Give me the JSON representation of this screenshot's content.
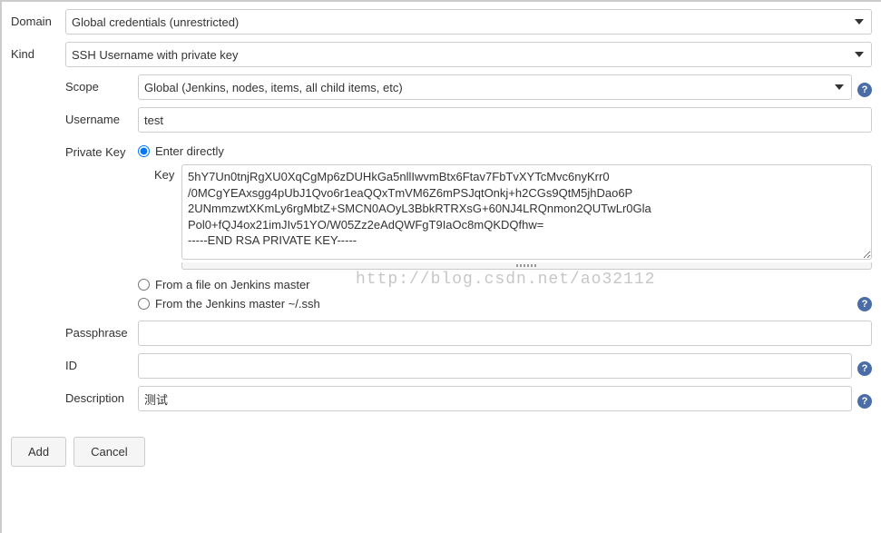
{
  "domain": {
    "label": "Domain",
    "value": "Global credentials (unrestricted)"
  },
  "kind": {
    "label": "Kind",
    "value": "SSH Username with private key"
  },
  "scope": {
    "label": "Scope",
    "value": "Global (Jenkins, nodes, items, all child items, etc)"
  },
  "username": {
    "label": "Username",
    "value": "test"
  },
  "privateKey": {
    "label": "Private Key",
    "option_enter_directly": "Enter directly",
    "key_label": "Key",
    "key_value": "5hY7Un0tnjRgXU0XqCgMp6zDUHkGa5nllIwvmBtx6Ftav7FbTvXYTcMvc6nyKrr0\n/0MCgYEAxsgg4pUbJ1Qvo6r1eaQQxTmVM6Z6mPSJqtOnkj+h2CGs9QtM5jhDao6P\n2UNmmzwtXKmLy6rgMbtZ+SMCN0AOyL3BbkRTRXsG+60NJ4LRQnmon2QUTwLr0Gla\nPol0+fQJ4ox21imJIv51YO/W05Zz2eAdQWFgT9IaOc8mQKDQfhw=\n-----END RSA PRIVATE KEY-----",
    "option_from_file": "From a file on Jenkins master",
    "option_from_ssh": "From the Jenkins master ~/.ssh"
  },
  "passphrase": {
    "label": "Passphrase",
    "value": ""
  },
  "id": {
    "label": "ID",
    "value": ""
  },
  "description": {
    "label": "Description",
    "value": "测试"
  },
  "buttons": {
    "add": "Add",
    "cancel": "Cancel"
  },
  "watermark": "http://blog.csdn.net/ao32112",
  "help_glyph": "?"
}
